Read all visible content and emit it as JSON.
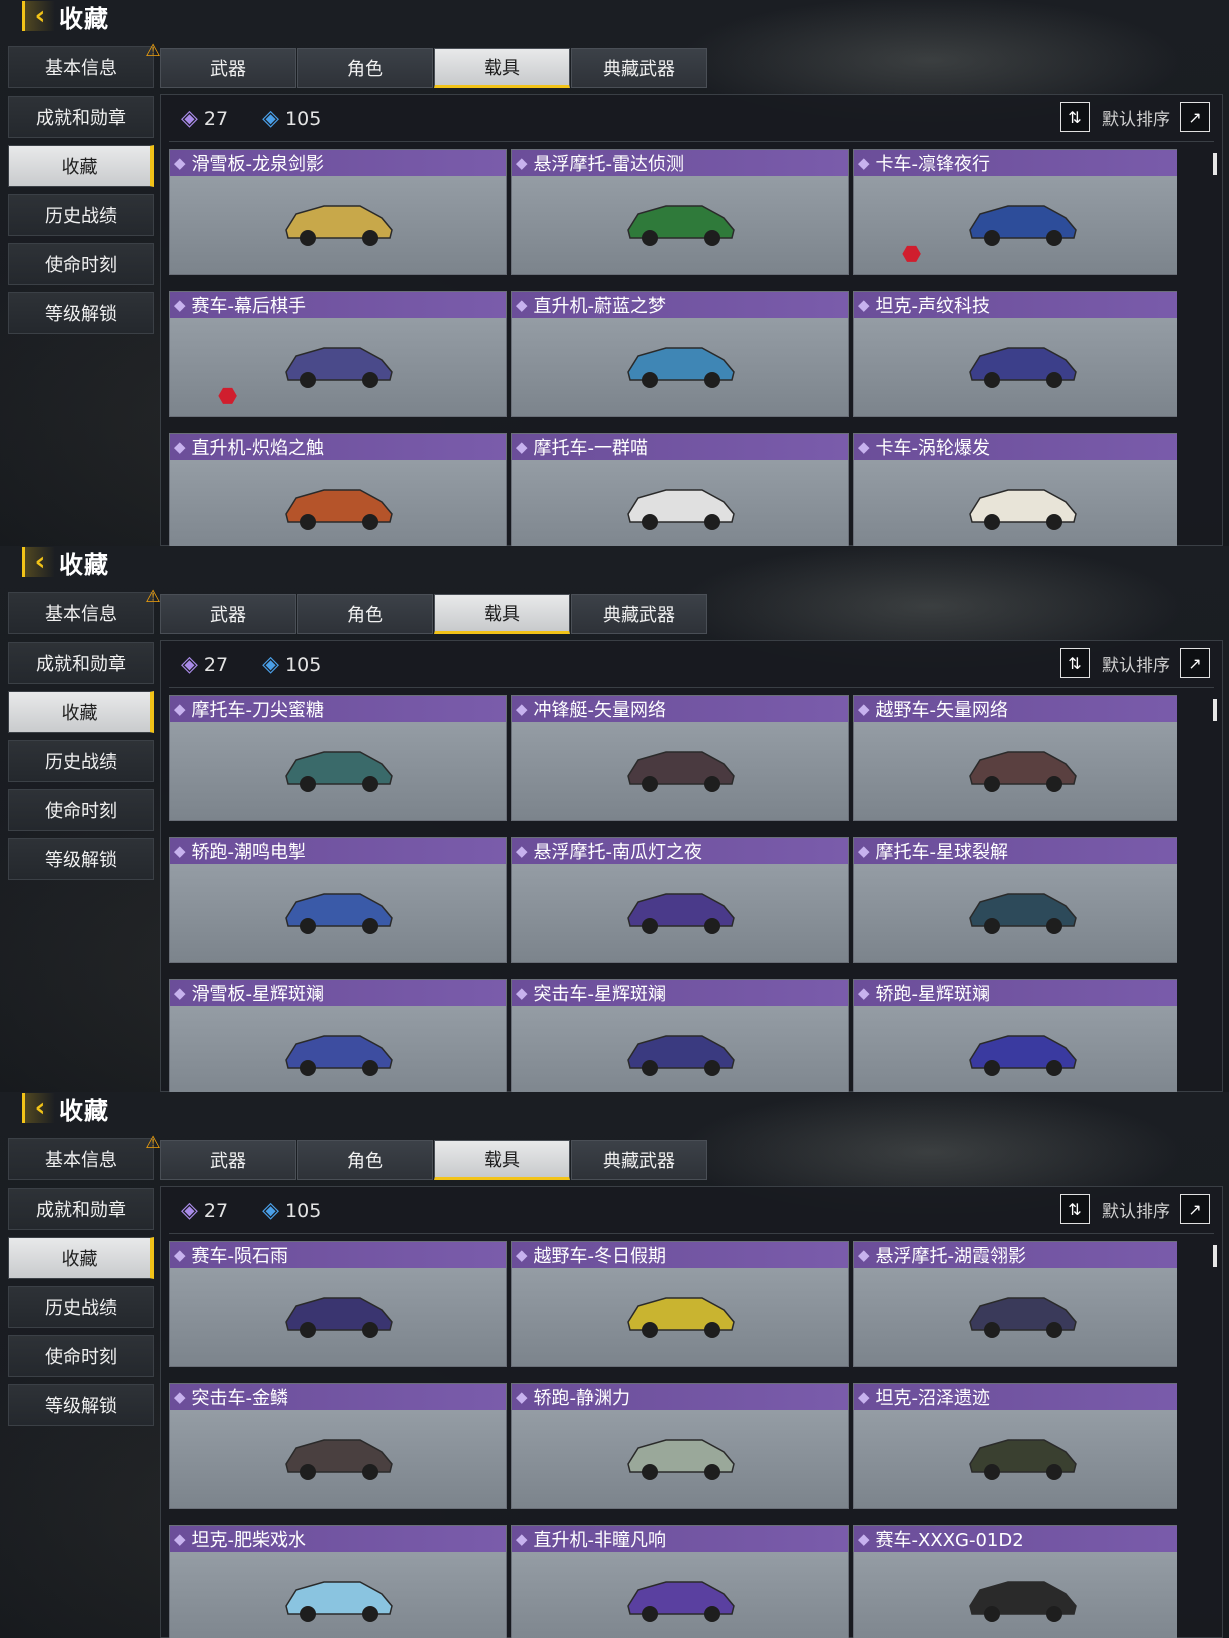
{
  "panels": [
    {
      "header": {
        "title": "收藏"
      },
      "sidebar": [
        "基本信息",
        "成就和勋章",
        "收藏",
        "历史战绩",
        "使命时刻",
        "等级解锁"
      ],
      "tabs": [
        "武器",
        "角色",
        "载具",
        "典藏武器"
      ],
      "stats": {
        "purple": "27",
        "blue": "105"
      },
      "sort_label": "默认排序",
      "items": [
        {
          "name": "滑雪板-龙泉剑影",
          "color": "#c8a84a",
          "marked": false
        },
        {
          "name": "悬浮摩托-雷达侦测",
          "color": "#2f7a3a",
          "marked": false
        },
        {
          "name": "卡车-凛锋夜行",
          "color": "#2d4d9a",
          "marked": true
        },
        {
          "name": "赛车-幕后棋手",
          "color": "#4a4a8a",
          "marked": true
        },
        {
          "name": "直升机-蔚蓝之梦",
          "color": "#3f86b5",
          "marked": false
        },
        {
          "name": "坦克-声纹科技",
          "color": "#3c3f8a",
          "marked": false
        },
        {
          "name": "直升机-炽焰之触",
          "color": "#b5542a",
          "marked": false
        },
        {
          "name": "摩托车-一群喵",
          "color": "#e0e0e0",
          "marked": false
        },
        {
          "name": "卡车-涡轮爆发",
          "color": "#e8e4d8",
          "marked": false
        }
      ]
    },
    {
      "header": {
        "title": "收藏"
      },
      "sidebar": [
        "基本信息",
        "成就和勋章",
        "收藏",
        "历史战绩",
        "使命时刻",
        "等级解锁"
      ],
      "tabs": [
        "武器",
        "角色",
        "载具",
        "典藏武器"
      ],
      "stats": {
        "purple": "27",
        "blue": "105"
      },
      "sort_label": "默认排序",
      "items": [
        {
          "name": "摩托车-刀尖蜜糖",
          "color": "#3a6a6a",
          "marked": false
        },
        {
          "name": "冲锋艇-矢量网络",
          "color": "#4a3a40",
          "marked": false
        },
        {
          "name": "越野车-矢量网络",
          "color": "#5a4040",
          "marked": false
        },
        {
          "name": "轿跑-潮鸣电掣",
          "color": "#3a5aa8",
          "marked": false
        },
        {
          "name": "悬浮摩托-南瓜灯之夜",
          "color": "#4a3a8a",
          "marked": false
        },
        {
          "name": "摩托车-星球裂解",
          "color": "#2d4a5a",
          "marked": false
        },
        {
          "name": "滑雪板-星辉斑斓",
          "color": "#3d4da0",
          "marked": false
        },
        {
          "name": "突击车-星辉斑斓",
          "color": "#3a3a80",
          "marked": false
        },
        {
          "name": "轿跑-星辉斑斓",
          "color": "#3a3aa0",
          "marked": false
        }
      ]
    },
    {
      "header": {
        "title": "收藏"
      },
      "sidebar": [
        "基本信息",
        "成就和勋章",
        "收藏",
        "历史战绩",
        "使命时刻",
        "等级解锁"
      ],
      "tabs": [
        "武器",
        "角色",
        "载具",
        "典藏武器"
      ],
      "stats": {
        "purple": "27",
        "blue": "105"
      },
      "sort_label": "默认排序",
      "items": [
        {
          "name": "赛车-陨石雨",
          "color": "#3a3570",
          "marked": false
        },
        {
          "name": "越野车-冬日假期",
          "color": "#c9b430",
          "marked": false
        },
        {
          "name": "悬浮摩托-湖霞翎影",
          "color": "#3a3a5a",
          "marked": false
        },
        {
          "name": "突击车-金鳞",
          "color": "#4a4040",
          "marked": false
        },
        {
          "name": "轿跑-静渊力",
          "color": "#9aa89a",
          "marked": false
        },
        {
          "name": "坦克-沼泽遗迹",
          "color": "#3a4030",
          "marked": false
        },
        {
          "name": "坦克-肥柴戏水",
          "color": "#8ac4e0",
          "marked": false
        },
        {
          "name": "直升机-非瞳凡响",
          "color": "#5a40a0",
          "marked": false
        },
        {
          "name": "赛车-XXXG-01D2",
          "color": "#2a2a2a",
          "marked": false
        }
      ]
    }
  ]
}
